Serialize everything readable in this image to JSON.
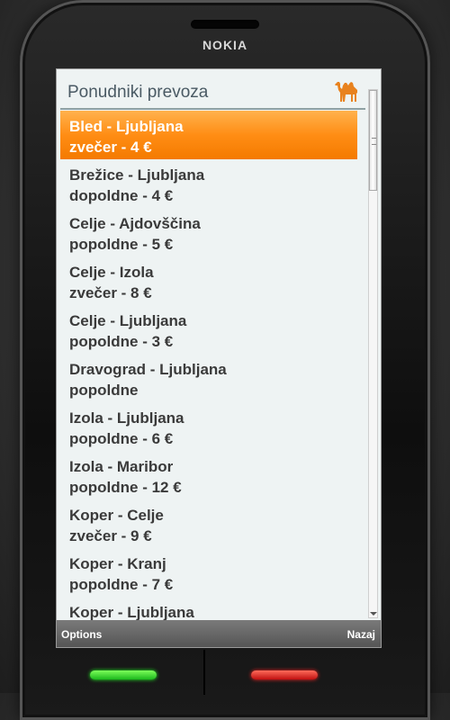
{
  "device": {
    "brand": "NOKIA"
  },
  "screen": {
    "title": "Ponudniki prevoza",
    "selected_index": 0,
    "items": [
      {
        "route": "Bled - Ljubljana",
        "detail": "zvečer - 4 €"
      },
      {
        "route": "Brežice - Ljubljana",
        "detail": "dopoldne - 4 €"
      },
      {
        "route": "Celje - Ajdovščina",
        "detail": "popoldne - 5 €"
      },
      {
        "route": "Celje - Izola",
        "detail": "zvečer - 8 €"
      },
      {
        "route": "Celje - Ljubljana",
        "detail": "popoldne - 3 €"
      },
      {
        "route": "Dravograd - Ljubljana",
        "detail": "popoldne"
      },
      {
        "route": "Izola - Ljubljana",
        "detail": "popoldne - 6 €"
      },
      {
        "route": "Izola - Maribor",
        "detail": "popoldne - 12 €"
      },
      {
        "route": "Koper - Celje",
        "detail": "zvečer - 9 €"
      },
      {
        "route": "Koper - Kranj",
        "detail": "popoldne - 7 €"
      },
      {
        "route": "Koper - Ljubljana",
        "detail": ""
      }
    ]
  },
  "softkeys": {
    "left": "Options",
    "right": "Nazaj"
  },
  "colors": {
    "accent": "#ff8d14",
    "title_text": "#4a5a64",
    "item_text": "#3a3a3a",
    "logo": "#e8821e"
  },
  "icons": {
    "logo": "camel-icon"
  }
}
